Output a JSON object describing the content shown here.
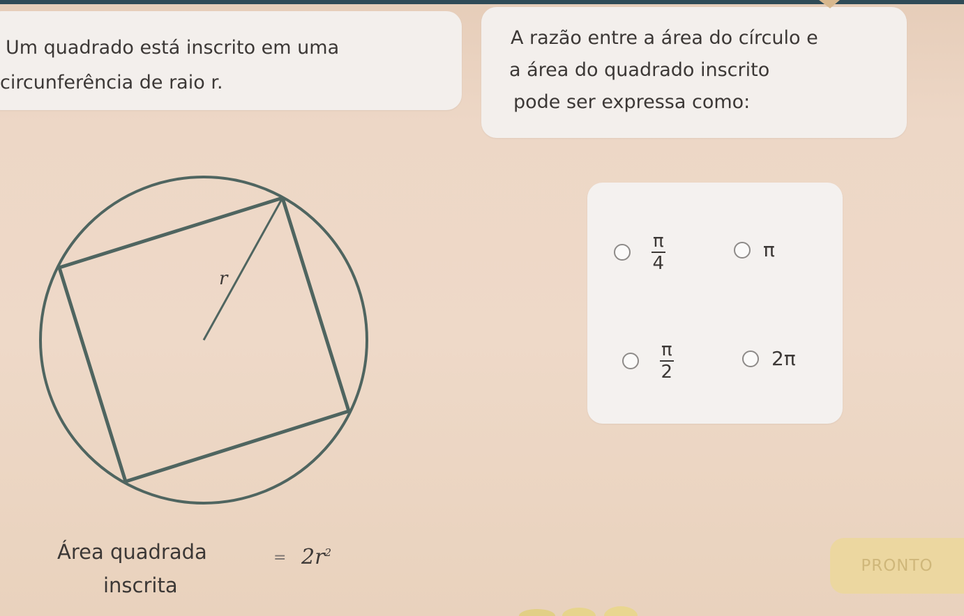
{
  "statement": {
    "line1": "Um quadrado está inscrito em uma",
    "line2": "circunferência de raio r."
  },
  "question": {
    "line1": "A razão entre a área do círculo e",
    "line2": "a área do quadrado inscrito",
    "line3": "pode ser expressa como:"
  },
  "options": [
    {
      "numerator": "π",
      "denominator": "4"
    },
    {
      "label": "π"
    },
    {
      "numerator": "π",
      "denominator": "2"
    },
    {
      "label": "2π"
    }
  ],
  "diagram": {
    "radius_label": "r"
  },
  "area_note": {
    "label_line1": "Área quadrada",
    "label_line2": "inscrita",
    "equals": "=",
    "formula_base": "2r",
    "formula_exponent": "2"
  },
  "done_button": {
    "label": "PRONTO"
  },
  "colors": {
    "background": "#eed9c8",
    "card": "#f3efec",
    "shape_stroke": "#4f6560",
    "button": "#ecd7a0",
    "button_text": "#cfb77a"
  }
}
